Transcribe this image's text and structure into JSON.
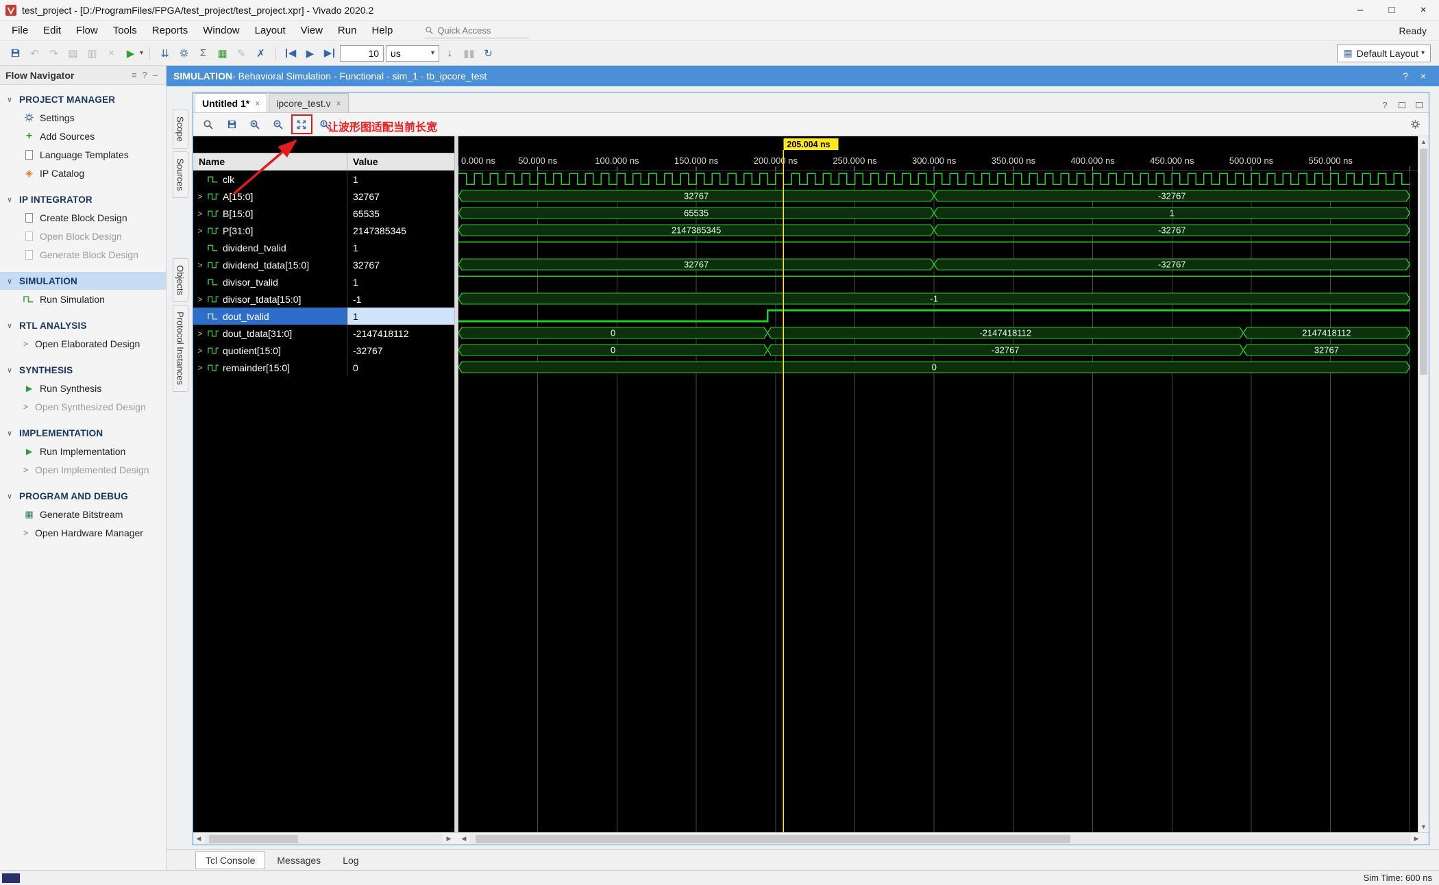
{
  "window": {
    "title": "test_project - [D:/ProgramFiles/FPGA/test_project/test_project.xpr] - Vivado 2020.2",
    "ready": "Ready"
  },
  "menus": [
    "File",
    "Edit",
    "Flow",
    "Tools",
    "Reports",
    "Window",
    "Layout",
    "View",
    "Run",
    "Help"
  ],
  "quick_access": {
    "label": "Quick Access"
  },
  "toolbar": {
    "time_value": "10",
    "time_unit": "us",
    "layout": "Default Layout"
  },
  "banner": {
    "section": "SIMULATION",
    "rest": " - Behavioral Simulation - Functional - sim_1 - tb_ipcore_test"
  },
  "icons": {
    "minimize": "–",
    "maximize": "□",
    "close": "×",
    "help": "?",
    "undo": "↶",
    "redo": "↷",
    "copy": "▤",
    "paste": "▥",
    "delete": "×",
    "play": "▶",
    "caret": "▾",
    "sigma": "Σ",
    "board": "▦",
    "edit": "✎",
    "cross": "✗",
    "left_tri": "◀",
    "right_tri": "▶",
    "step_down": "↓",
    "pause": "▮▮",
    "relaunch": "↻",
    "goto_start": "⇤",
    "goto_end": "⇥",
    "fit_width": "↔",
    "plus": "+",
    "section_chevron": "∨",
    "chevron_right": ">",
    "menu": "≡",
    "dash": "–",
    "up": "▲",
    "down": "▼",
    "tab_close": "×",
    "ip": "◈",
    "bitstream": "▦",
    "step": "⇊"
  },
  "flow_navigator": {
    "title": "Flow Navigator",
    "sections": [
      {
        "label": "PROJECT MANAGER",
        "items": [
          {
            "label": "Settings"
          },
          {
            "label": "Add Sources"
          },
          {
            "label": "Language Templates"
          },
          {
            "label": "IP Catalog"
          }
        ]
      },
      {
        "label": "IP INTEGRATOR",
        "items": [
          {
            "label": "Create Block Design"
          },
          {
            "label": "Open Block Design",
            "disabled": true
          },
          {
            "label": "Generate Block Design",
            "disabled": true
          }
        ]
      },
      {
        "label": "SIMULATION",
        "selected": true,
        "items": [
          {
            "label": "Run Simulation"
          }
        ]
      },
      {
        "label": "RTL ANALYSIS",
        "items": [
          {
            "label": "Open Elaborated Design",
            "chevron": true
          }
        ]
      },
      {
        "label": "SYNTHESIS",
        "items": [
          {
            "label": "Run Synthesis"
          },
          {
            "label": "Open Synthesized Design",
            "disabled": true,
            "chevron": true
          }
        ]
      },
      {
        "label": "IMPLEMENTATION",
        "items": [
          {
            "label": "Run Implementation"
          },
          {
            "label": "Open Implemented Design",
            "disabled": true,
            "chevron": true
          }
        ]
      },
      {
        "label": "PROGRAM AND DEBUG",
        "items": [
          {
            "label": "Generate Bitstream"
          },
          {
            "label": "Open Hardware Manager",
            "chevron": true
          }
        ]
      }
    ]
  },
  "side_tabs": [
    "Scope",
    "Sources",
    "Objects",
    "Protocol Instances"
  ],
  "wave_window": {
    "tabs": [
      {
        "label": "Untitled 1*"
      },
      {
        "label": "ipcore_test.v"
      }
    ],
    "columns": {
      "name": "Name",
      "value": "Value"
    },
    "annotation": "让波形图适配当前长宽"
  },
  "bottom_tabs": [
    "Tcl Console",
    "Messages",
    "Log"
  ],
  "status_bar": {
    "sim_time": "Sim Time: 600 ns"
  },
  "chart_data": {
    "type": "waveform",
    "time_unit": "ns",
    "visible_range": [
      0,
      605
    ],
    "data_end": 600,
    "cursor": {
      "time": 205.004,
      "label": "205.004 ns"
    },
    "ticks": [
      {
        "t": 0,
        "label": "0.000 ns"
      },
      {
        "t": 50,
        "label": "50.000 ns"
      },
      {
        "t": 100,
        "label": "100.000 ns"
      },
      {
        "t": 150,
        "label": "150.000 ns"
      },
      {
        "t": 200,
        "label": "200.000 ns"
      },
      {
        "t": 250,
        "label": "250.000 ns"
      },
      {
        "t": 300,
        "label": "300.000 ns"
      },
      {
        "t": 350,
        "label": "350.000 ns"
      },
      {
        "t": 400,
        "label": "400.000 ns"
      },
      {
        "t": 450,
        "label": "450.000 ns"
      },
      {
        "t": 500,
        "label": "500.000 ns"
      },
      {
        "t": 550,
        "label": "550.000 ns"
      },
      {
        "t": 600,
        "label": ""
      }
    ],
    "colors": {
      "background": "#000000",
      "grid": "#4a4a4a",
      "wave": "#1fd41f",
      "bus_fill": "#0d2f0d",
      "label": "#eaffea",
      "cursor": "#ffee00",
      "cursor_label_bg": "#ffe81a"
    },
    "signals": [
      {
        "name": "clk",
        "value": "1",
        "kind": "clock",
        "period": 10
      },
      {
        "name": "A[15:0]",
        "value": "32767",
        "kind": "bus",
        "segments": [
          {
            "from": 0,
            "to": 300,
            "label": "32767"
          },
          {
            "from": 300,
            "to": 600,
            "label": "-32767"
          }
        ]
      },
      {
        "name": "B[15:0]",
        "value": "65535",
        "kind": "bus",
        "segments": [
          {
            "from": 0,
            "to": 300,
            "label": "65535"
          },
          {
            "from": 300,
            "to": 600,
            "label": "1"
          }
        ]
      },
      {
        "name": "P[31:0]",
        "value": "2147385345",
        "kind": "bus",
        "segments": [
          {
            "from": 0,
            "to": 300,
            "label": "2147385345"
          },
          {
            "from": 300,
            "to": 600,
            "label": "-32767"
          }
        ]
      },
      {
        "name": "dividend_tvalid",
        "value": "1",
        "kind": "bit",
        "segments": [
          {
            "from": 0,
            "to": 600,
            "level": 1
          }
        ]
      },
      {
        "name": "dividend_tdata[15:0]",
        "value": "32767",
        "kind": "bus",
        "segments": [
          {
            "from": 0,
            "to": 300,
            "label": "32767"
          },
          {
            "from": 300,
            "to": 600,
            "label": "-32767"
          }
        ]
      },
      {
        "name": "divisor_tvalid",
        "value": "1",
        "kind": "bit",
        "segments": [
          {
            "from": 0,
            "to": 600,
            "level": 1
          }
        ]
      },
      {
        "name": "divisor_tdata[15:0]",
        "value": "-1",
        "kind": "bus",
        "segments": [
          {
            "from": 0,
            "to": 600,
            "label": "-1"
          }
        ]
      },
      {
        "name": "dout_tvalid",
        "value": "1",
        "kind": "bit",
        "selected": true,
        "segments": [
          {
            "from": 0,
            "to": 195,
            "level": 0
          },
          {
            "from": 195,
            "to": 600,
            "level": 1
          }
        ]
      },
      {
        "name": "dout_tdata[31:0]",
        "value": "-2147418112",
        "kind": "bus",
        "segments": [
          {
            "from": 0,
            "to": 195,
            "label": "0"
          },
          {
            "from": 195,
            "to": 495,
            "label": "-2147418112"
          },
          {
            "from": 495,
            "to": 600,
            "label": "2147418112"
          }
        ]
      },
      {
        "name": "quotient[15:0]",
        "value": "-32767",
        "kind": "bus",
        "segments": [
          {
            "from": 0,
            "to": 195,
            "label": "0"
          },
          {
            "from": 195,
            "to": 495,
            "label": "-32767"
          },
          {
            "from": 495,
            "to": 600,
            "label": "32767"
          }
        ]
      },
      {
        "name": "remainder[15:0]",
        "value": "0",
        "kind": "bus",
        "segments": [
          {
            "from": 0,
            "to": 600,
            "label": "0"
          }
        ]
      }
    ]
  }
}
